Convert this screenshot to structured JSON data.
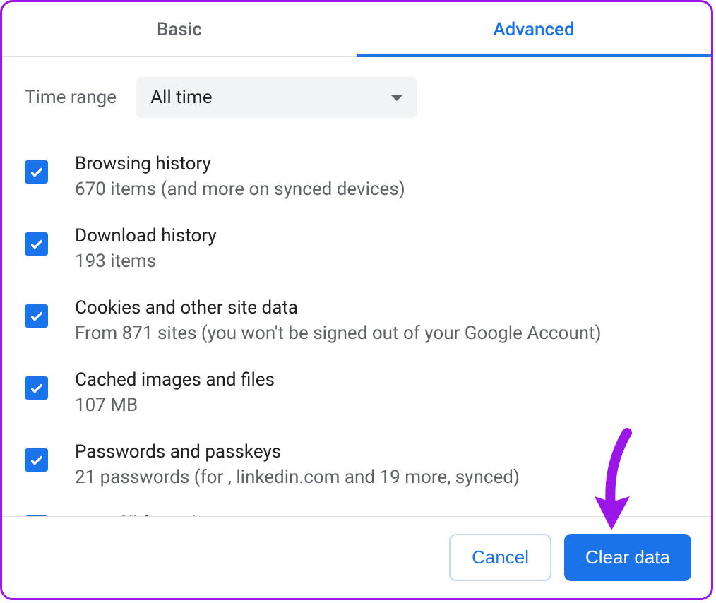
{
  "tabs": {
    "basic": "Basic",
    "advanced": "Advanced"
  },
  "timeRange": {
    "label": "Time range",
    "selected": "All time"
  },
  "options": [
    {
      "title": "Browsing history",
      "desc": "670 items (and more on synced devices)",
      "checked": true
    },
    {
      "title": "Download history",
      "desc": "193 items",
      "checked": true
    },
    {
      "title": "Cookies and other site data",
      "desc": "From 871 sites (you won't be signed out of your Google Account)",
      "checked": true
    },
    {
      "title": "Cached images and files",
      "desc": "107 MB",
      "checked": true
    },
    {
      "title": "Passwords and passkeys",
      "desc": "21 passwords (for , linkedin.com and 19 more, synced)",
      "checked": true
    },
    {
      "title": "Auto-fill form data",
      "desc": "",
      "checked": true
    }
  ],
  "footer": {
    "cancel": "Cancel",
    "clear": "Clear data"
  }
}
